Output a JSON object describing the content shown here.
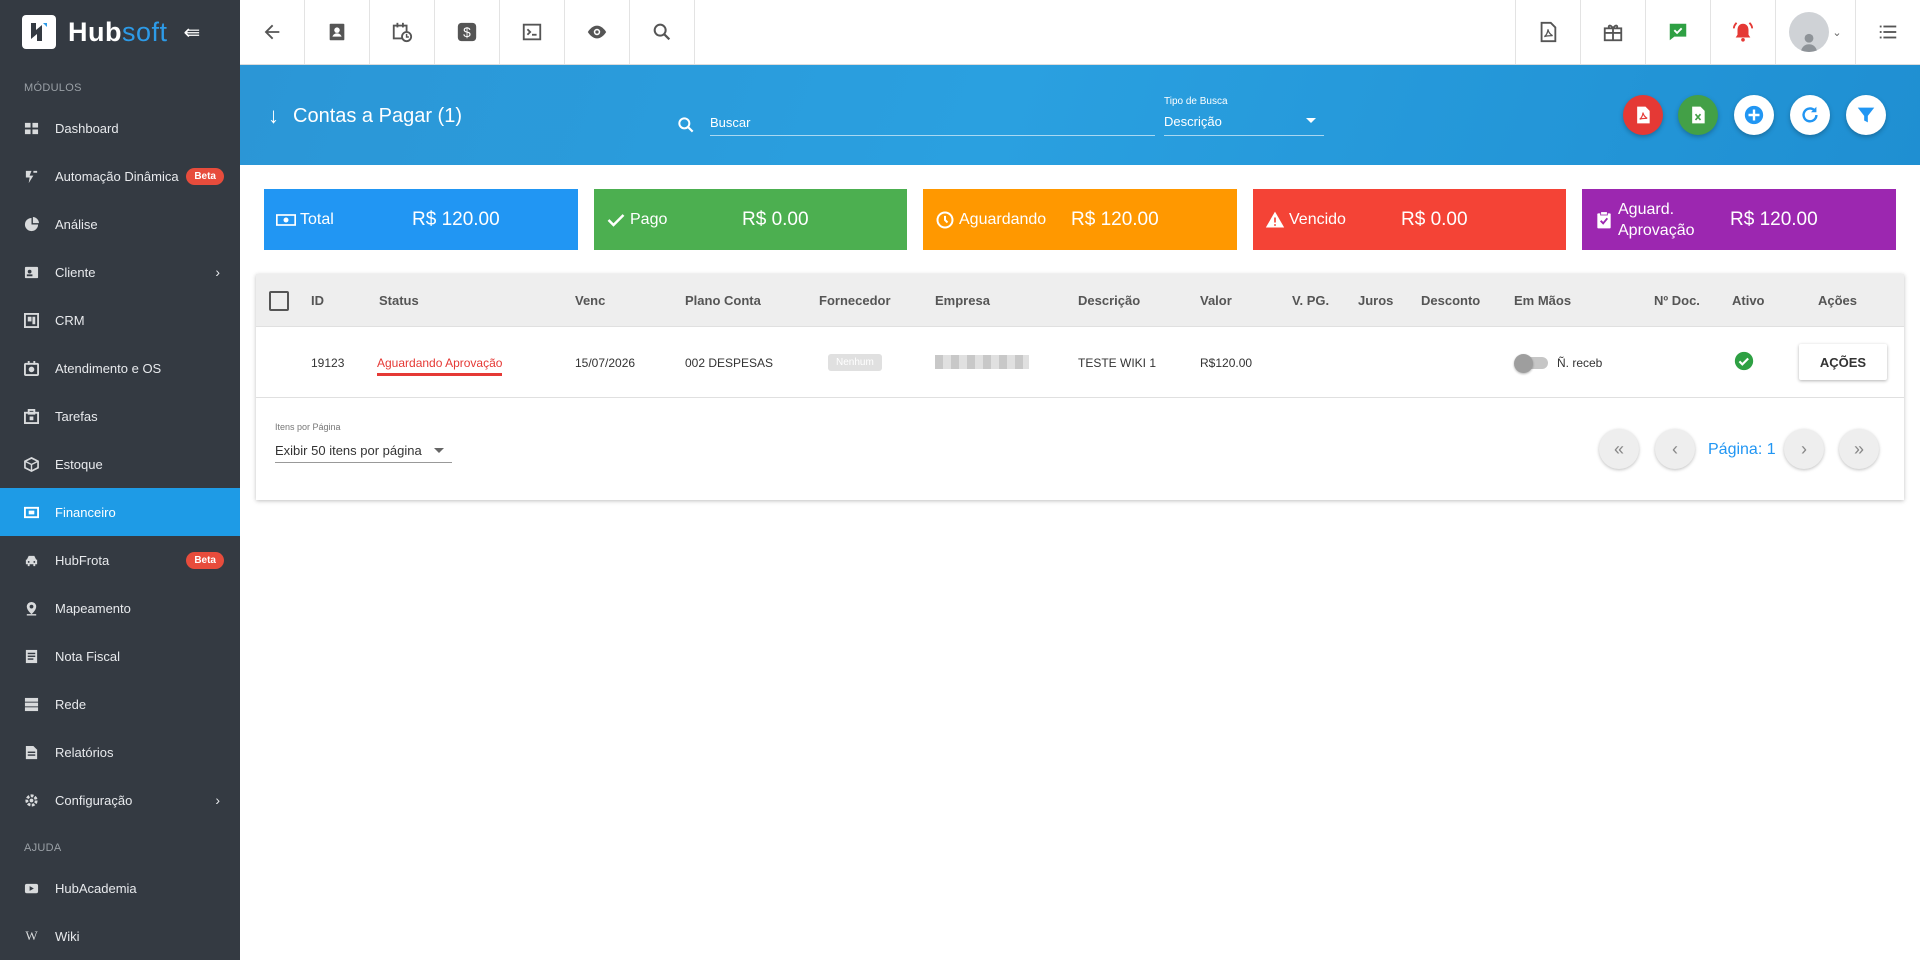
{
  "app": {
    "logo_main": "Hub",
    "logo_accent": "soft",
    "collapse_icon": "collapse-arrow-icon"
  },
  "sidebar": {
    "section_modules": "MÓDULOS",
    "section_help": "AJUDA",
    "items": [
      {
        "label": "Dashboard",
        "icon": "dashboard-icon"
      },
      {
        "label": "Automação Dinâmica",
        "icon": "automation-icon",
        "badge": "Beta"
      },
      {
        "label": "Análise",
        "icon": "pie-chart-icon"
      },
      {
        "label": "Cliente",
        "icon": "client-card-icon",
        "has_children": true
      },
      {
        "label": "CRM",
        "icon": "crm-icon"
      },
      {
        "label": "Atendimento e OS",
        "icon": "service-icon"
      },
      {
        "label": "Tarefas",
        "icon": "tasks-icon"
      },
      {
        "label": "Estoque",
        "icon": "box-icon"
      },
      {
        "label": "Financeiro",
        "icon": "finance-icon",
        "active": true
      },
      {
        "label": "HubFrota",
        "icon": "car-icon",
        "badge": "Beta"
      },
      {
        "label": "Mapeamento",
        "icon": "map-pin-icon"
      },
      {
        "label": "Nota Fiscal",
        "icon": "invoice-icon"
      },
      {
        "label": "Rede",
        "icon": "network-icon"
      },
      {
        "label": "Relatórios",
        "icon": "report-icon"
      },
      {
        "label": "Configuração",
        "icon": "gear-icon",
        "has_children": true
      }
    ],
    "help_items": [
      {
        "label": "HubAcademia",
        "icon": "youtube-icon"
      },
      {
        "label": "Wiki",
        "icon": "wikipedia-icon"
      }
    ]
  },
  "topbar": {
    "left_icons": [
      "back-arrow-icon",
      "contact-card-icon",
      "calendar-clock-icon",
      "dollar-icon",
      "terminal-icon",
      "eye-icon",
      "search-icon"
    ],
    "right_icons": [
      "pdf-file-icon",
      "gift-icon",
      "chat-check-icon",
      "alarm-bell-icon",
      "user-avatar-icon",
      "list-menu-icon"
    ],
    "colors": {
      "chat": "#2ea043",
      "alarm": "#e53935"
    }
  },
  "header": {
    "title": "Contas a Pagar (1)",
    "search_placeholder": "Buscar",
    "search_type_label": "Tipo de Busca",
    "search_type_value": "Descrição",
    "actions": [
      {
        "name": "pdf-export",
        "icon": "pdf-icon",
        "color": "#e53935"
      },
      {
        "name": "excel-export",
        "icon": "excel-icon",
        "color": "#43a047"
      },
      {
        "name": "add",
        "icon": "plus-circle-icon",
        "color": "#ffffff"
      },
      {
        "name": "refresh",
        "icon": "refresh-icon",
        "color": "#ffffff"
      },
      {
        "name": "filter",
        "icon": "filter-icon",
        "color": "#ffffff"
      }
    ]
  },
  "summary": [
    {
      "label": "Total",
      "value": "R$ 120.00",
      "color": "#2196f3",
      "icon": "money-icon"
    },
    {
      "label": "Pago",
      "value": "R$ 0.00",
      "color": "#4caf50",
      "icon": "check-icon"
    },
    {
      "label": "Aguardando",
      "value": "R$ 120.00",
      "color": "#ff9800",
      "icon": "clock-icon"
    },
    {
      "label": "Vencido",
      "value": "R$ 0.00",
      "color": "#f44336",
      "icon": "warning-icon"
    },
    {
      "label": "Aguard. Aprovação",
      "value": "R$ 120.00",
      "color": "#9c27b0",
      "icon": "clipboard-check-icon"
    }
  ],
  "table": {
    "columns": [
      "ID",
      "Status",
      "Venc",
      "Plano Conta",
      "Fornecedor",
      "Empresa",
      "Descrição",
      "Valor",
      "V. PG.",
      "Juros",
      "Desconto",
      "Em Mãos",
      "Nº Doc.",
      "Ativo",
      "Ações"
    ],
    "rows": [
      {
        "id": "19123",
        "status": "Aguardando Aprovação",
        "status_color": "#e53935",
        "venc": "15/07/2026",
        "plano_conta": "002 DESPESAS",
        "fornecedor": "Nenhum",
        "empresa": "",
        "descricao": "TESTE WIKI 1",
        "valor": "R$120.00",
        "v_pg": "",
        "juros": "",
        "desconto": "",
        "em_maos": "Ñ. receb",
        "n_doc": "",
        "ativo_icon": "check-circle-icon",
        "acoes_label": "AÇÕES"
      }
    ]
  },
  "pagination": {
    "per_page_label": "Itens por Página",
    "per_page_value": "Exibir 50 itens por página",
    "page_label": "Página: 1"
  }
}
